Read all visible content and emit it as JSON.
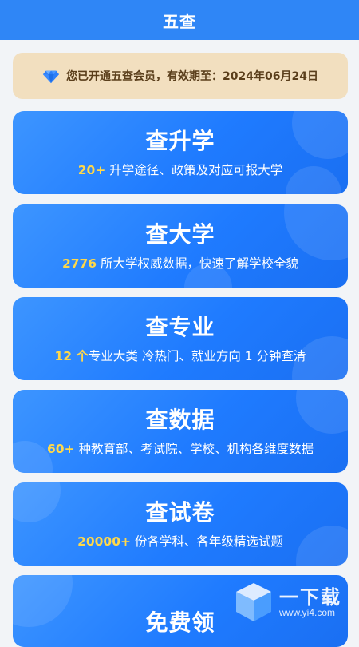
{
  "header": {
    "title": "五查"
  },
  "membership": {
    "icon": "diamond-icon",
    "text": "您已开通五查会员，有效期至：2024年06月24日"
  },
  "cards": [
    {
      "title": "查升学",
      "highlight": "20+",
      "desc": " 升学途径、政策及对应可报大学"
    },
    {
      "title": "查大学",
      "highlight": "2776",
      "desc": " 所大学权威数据，快速了解学校全貌"
    },
    {
      "title": "查专业",
      "highlight": "12 个",
      "desc": "专业大类 冷热门、就业方向 1 分钟查清"
    },
    {
      "title": "查数据",
      "highlight": "60+",
      "desc": " 种教育部、考试院、学校、机构各维度数据"
    },
    {
      "title": "查试卷",
      "highlight": "20000+",
      "desc": " 份各学科、各年级精选试题"
    },
    {
      "title": "免费领"
    }
  ],
  "watermark": {
    "brand": "一下载",
    "site": "www.yi4.com"
  },
  "colors": {
    "header": "#2f86f6",
    "card": "#1f7bff",
    "highlight": "#ffd84a",
    "membership_bg": "#f2dfbf"
  }
}
